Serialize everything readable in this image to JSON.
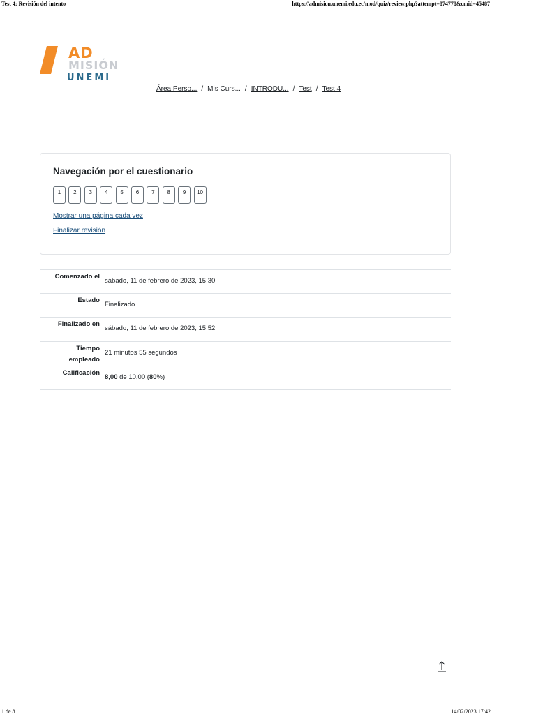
{
  "print_header": {
    "left": "Test 4: Revisión del intento",
    "right": "https://admision.unemi.edu.ec/mod/quiz/review.php?attempt=874778&cmid=45487"
  },
  "print_footer": {
    "left": "1 de 8",
    "right": "14/02/2023 17:42"
  },
  "logo": {
    "top_text": "AD",
    "faded_text": "MISIÓN",
    "bottom_text": "UNEMI",
    "accent_color": "#f28c28",
    "secondary_color": "#2b6a8c"
  },
  "breadcrumb": [
    {
      "label": "Área Perso..."
    },
    {
      "label": "Mis Curs..."
    },
    {
      "label": "INTRODU..."
    },
    {
      "label": "Test"
    },
    {
      "label": "Test 4"
    }
  ],
  "quiz_nav": {
    "title": "Navegación por el cuestionario",
    "questions": [
      "1",
      "2",
      "3",
      "4",
      "5",
      "6",
      "7",
      "8",
      "9",
      "10"
    ],
    "show_one_page": "Mostrar una página cada vez",
    "finish_review": "Finalizar revisión"
  },
  "summary": {
    "started_label": "Comenzado el",
    "started_value": "sábado, 11 de febrero de 2023, 15:30",
    "state_label": "Estado",
    "state_value": "Finalizado",
    "finished_label": "Finalizado en",
    "finished_value": "sábado, 11 de febrero de 2023, 15:52",
    "time_label_1": "Tiempo",
    "time_label_2": "empleado",
    "time_value": "21 minutos 55 segundos",
    "grade_label": "Calificación",
    "grade_score": "8,00",
    "grade_of": " de 10,00 (",
    "grade_percent": "80",
    "grade_close": "%)"
  },
  "icons": {
    "back_to_top": "arrow-up-icon"
  }
}
